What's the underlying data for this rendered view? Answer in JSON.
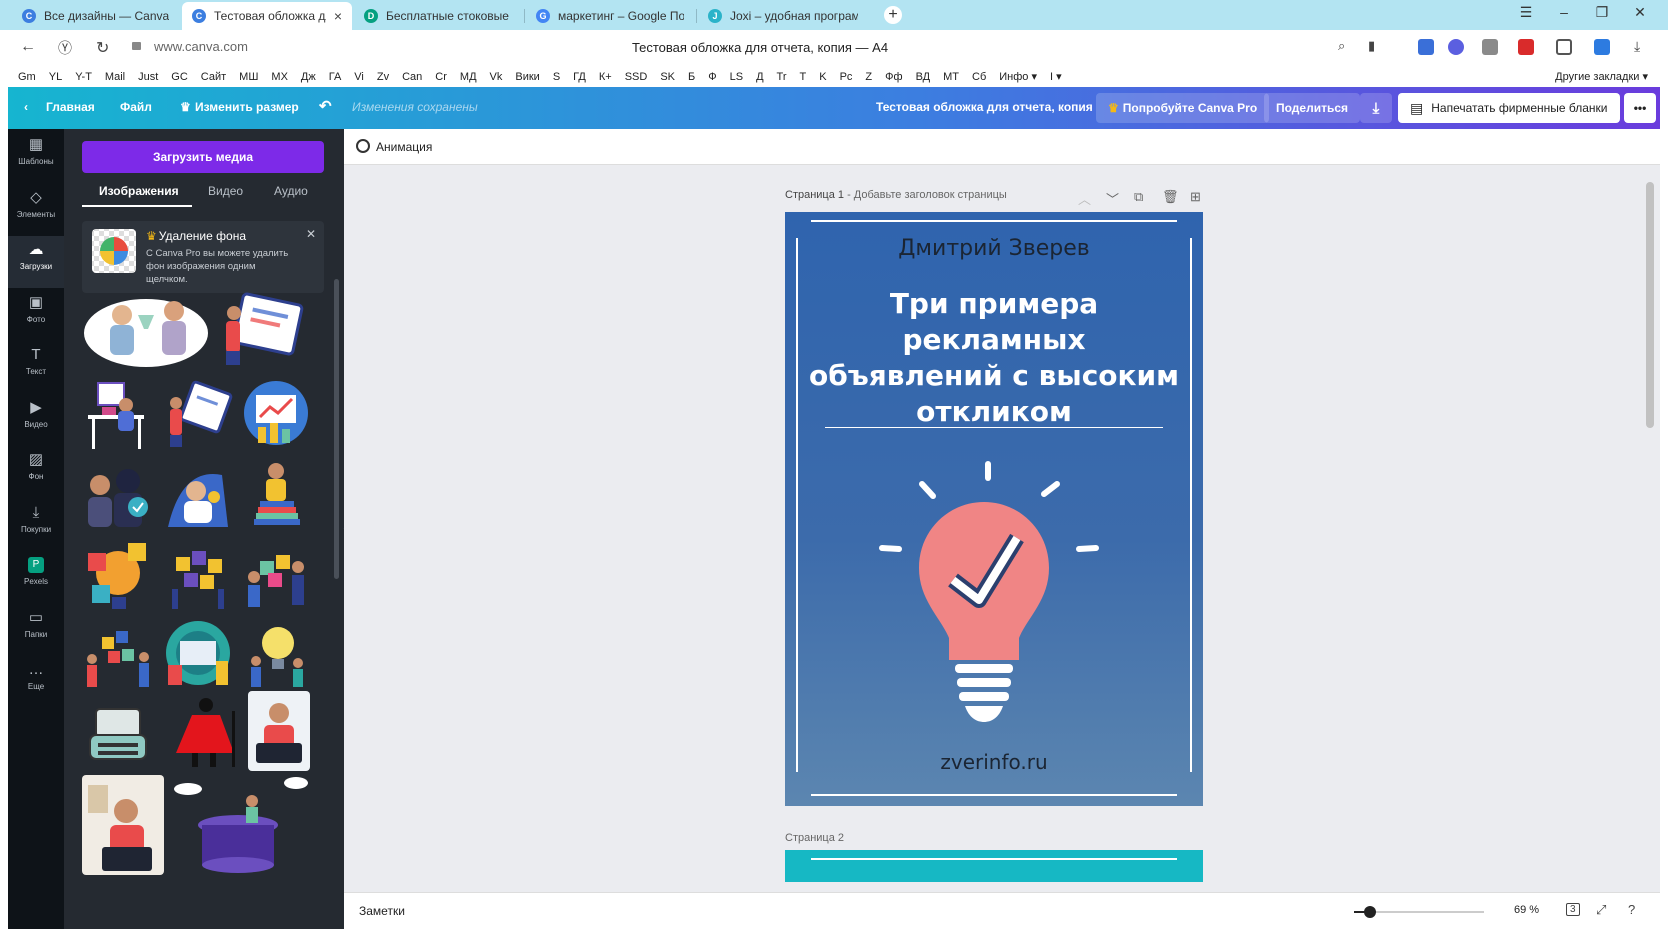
{
  "browser": {
    "tabs": [
      {
        "title": "Все дизайны — Canva",
        "favicon_color": "#3c7ee0",
        "favicon_glyph": "C",
        "active": false
      },
      {
        "title": "Тестовая обложка для",
        "favicon_color": "#3c7ee0",
        "favicon_glyph": "C",
        "active": true
      },
      {
        "title": "Бесплатные стоковые фо",
        "favicon_color": "#05a081",
        "favicon_glyph": "D",
        "active": false
      },
      {
        "title": "маркетинг – Google Поис",
        "favicon_color": "#4285f4",
        "favicon_glyph": "G",
        "active": false
      },
      {
        "title": "Joxi – удобная программа",
        "favicon_color": "#2bb3c9",
        "favicon_glyph": "J",
        "active": false
      }
    ],
    "new_tab_label": "+",
    "url": "www.canva.com",
    "page_title": "Тестовая обложка для отчета, копия — A4",
    "bookmarks": [
      "Gm",
      "YL",
      "Y-T",
      "Mail",
      "Just",
      "GC",
      "Сайт",
      "МШ",
      "МХ",
      "Дж",
      "ГА",
      "Vi",
      "Zv",
      "Can",
      "Cr",
      "МД",
      "Vk",
      "Вики",
      "S",
      "ГД",
      "К+",
      "SSD",
      "SK",
      "Б",
      "Ф",
      "LS",
      "Д",
      "Tr",
      "T",
      "K",
      "Pc",
      "Z",
      "Фф",
      "ВД",
      "МТ",
      "Сб",
      "Инфо ▾",
      "I ▾"
    ],
    "other_bookmarks": "Другие закладки ▾"
  },
  "canva_top": {
    "home": "Главная",
    "file": "Файл",
    "resize": "Изменить размер",
    "saved_status": "Изменения сохранены",
    "design_name": "Тестовая обложка для отчета, копия",
    "try_pro": "Попробуйте Canva Pro",
    "share": "Поделиться",
    "print": "Напечатать фирменные бланки"
  },
  "rail": [
    {
      "label": "Шаблоны",
      "icon": "templates-icon",
      "glyph": "▦"
    },
    {
      "label": "Элементы",
      "icon": "elements-icon",
      "glyph": "◇"
    },
    {
      "label": "Загрузки",
      "icon": "uploads-icon",
      "glyph": "☁",
      "active": true
    },
    {
      "label": "Фото",
      "icon": "photo-icon",
      "glyph": "▣"
    },
    {
      "label": "Текст",
      "icon": "text-icon",
      "glyph": "T"
    },
    {
      "label": "Видео",
      "icon": "video-icon",
      "glyph": "▶"
    },
    {
      "label": "Фон",
      "icon": "background-icon",
      "glyph": "▨"
    },
    {
      "label": "Покупки",
      "icon": "purchases-icon",
      "glyph": "⤓"
    },
    {
      "label": "Pexels",
      "icon": "pexels-icon",
      "glyph": "P"
    },
    {
      "label": "Папки",
      "icon": "folders-icon",
      "glyph": "▭"
    },
    {
      "label": "Еще",
      "icon": "more-icon",
      "glyph": "…"
    }
  ],
  "panel": {
    "upload_button": "Загрузить медиа",
    "tabs": [
      "Изображения",
      "Видео",
      "Аудио"
    ],
    "promo_title": "Удаление фона",
    "promo_text": "С Canva Pro вы можете удалить фон изображения одним щелчком."
  },
  "editor": {
    "animation": "Анимация",
    "page1_label": "Страница 1",
    "page1_hint": " - Добавьте заголовок страницы",
    "page2_label": "Страница 2",
    "cover": {
      "author": "Дмитрий Зверев",
      "title": "Три примера рекламных объявлений с высоким откликом",
      "site": "zverinfo.ru"
    }
  },
  "bottom": {
    "notes": "Заметки",
    "zoom": "69 %",
    "zoom_level": 0.12,
    "page_count": "3"
  },
  "colors": {
    "canva_purple": "#7d2ae8",
    "cover_blue": "#2f64ae",
    "bulb": "#f08585",
    "page2_teal": "#16b8c4"
  }
}
